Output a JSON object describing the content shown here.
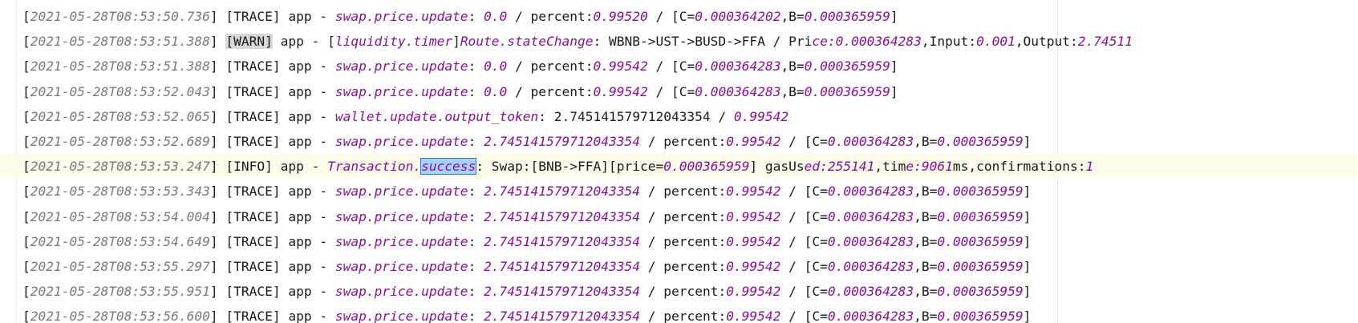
{
  "log": {
    "lines": [
      {
        "ts": "2021-05-28T08:53:50.736",
        "level": "TRACE",
        "logger": "app",
        "segments": [
          {
            "t": "swap.price.update",
            "s": "it"
          },
          {
            "t": ": ",
            "s": "plain"
          },
          {
            "t": "0.0",
            "s": "num"
          },
          {
            "t": " / percent:",
            "s": "plain"
          },
          {
            "t": "0.99520",
            "s": "num"
          },
          {
            "t": " / [C=",
            "s": "plain"
          },
          {
            "t": "0.000364202",
            "s": "num"
          },
          {
            "t": ",B=",
            "s": "plain"
          },
          {
            "t": "0.000365959",
            "s": "num"
          },
          {
            "t": "]",
            "s": "plain"
          }
        ]
      },
      {
        "ts": "2021-05-28T08:53:51.388",
        "level": "WARN",
        "logger": "app",
        "segments": [
          {
            "t": "[",
            "s": "plain"
          },
          {
            "t": "liquidity.timer",
            "s": "it"
          },
          {
            "t": "]",
            "s": "plain"
          },
          {
            "t": "Route.stateChange",
            "s": "it"
          },
          {
            "t": ": WBNB->UST->BUSD->FFA / Pri",
            "s": "plain"
          },
          {
            "t": "ce:0.000364283",
            "s": "num"
          },
          {
            "t": ",Input:",
            "s": "plain"
          },
          {
            "t": "0.001",
            "s": "num"
          },
          {
            "t": ",Output:",
            "s": "plain"
          },
          {
            "t": "2.74511",
            "s": "num"
          }
        ]
      },
      {
        "ts": "2021-05-28T08:53:51.388",
        "level": "TRACE",
        "logger": "app",
        "segments": [
          {
            "t": "swap.price.update",
            "s": "it"
          },
          {
            "t": ": ",
            "s": "plain"
          },
          {
            "t": "0.0",
            "s": "num"
          },
          {
            "t": " / percent:",
            "s": "plain"
          },
          {
            "t": "0.99542",
            "s": "num"
          },
          {
            "t": " / [C=",
            "s": "plain"
          },
          {
            "t": "0.000364283",
            "s": "num"
          },
          {
            "t": ",B=",
            "s": "plain"
          },
          {
            "t": "0.000365959",
            "s": "num"
          },
          {
            "t": "]",
            "s": "plain"
          }
        ]
      },
      {
        "ts": "2021-05-28T08:53:52.043",
        "level": "TRACE",
        "logger": "app",
        "segments": [
          {
            "t": "swap.price.update",
            "s": "it"
          },
          {
            "t": ": ",
            "s": "plain"
          },
          {
            "t": "0.0",
            "s": "num"
          },
          {
            "t": " / percent:",
            "s": "plain"
          },
          {
            "t": "0.99542",
            "s": "num"
          },
          {
            "t": " / [C=",
            "s": "plain"
          },
          {
            "t": "0.000364283",
            "s": "num"
          },
          {
            "t": ",B=",
            "s": "plain"
          },
          {
            "t": "0.000365959",
            "s": "num"
          },
          {
            "t": "]",
            "s": "plain"
          }
        ]
      },
      {
        "ts": "2021-05-28T08:53:52.065",
        "level": "TRACE",
        "logger": "app",
        "segments": [
          {
            "t": "wallet.update.output_token",
            "s": "it"
          },
          {
            "t": ": 2.745141579712043354 / ",
            "s": "plain"
          },
          {
            "t": "0.99542",
            "s": "num"
          }
        ]
      },
      {
        "ts": "2021-05-28T08:53:52.689",
        "level": "TRACE",
        "logger": "app",
        "segments": [
          {
            "t": "swap.price.update",
            "s": "it"
          },
          {
            "t": ": ",
            "s": "plain"
          },
          {
            "t": "2.745141579712043354",
            "s": "num"
          },
          {
            "t": " / percent:",
            "s": "plain"
          },
          {
            "t": "0.99542",
            "s": "num"
          },
          {
            "t": " / [C=",
            "s": "plain"
          },
          {
            "t": "0.000364283",
            "s": "num"
          },
          {
            "t": ",B=",
            "s": "plain"
          },
          {
            "t": "0.000365959",
            "s": "num"
          },
          {
            "t": "]",
            "s": "plain"
          }
        ]
      },
      {
        "ts": "2021-05-28T08:53:53.247",
        "level": "INFO",
        "logger": "app",
        "current": true,
        "segments": [
          {
            "t": "Transaction.",
            "s": "it"
          },
          {
            "t": "success",
            "s": "sel"
          },
          {
            "t": ": Swap:[BNB->FFA][price=",
            "s": "plain"
          },
          {
            "t": "0.000365959",
            "s": "num"
          },
          {
            "t": "] gasUs",
            "s": "plain"
          },
          {
            "t": "ed:255141",
            "s": "num"
          },
          {
            "t": ",tim",
            "s": "plain"
          },
          {
            "t": "e:9061",
            "s": "num"
          },
          {
            "t": "ms,confirmations:",
            "s": "plain"
          },
          {
            "t": "1",
            "s": "num"
          }
        ]
      },
      {
        "ts": "2021-05-28T08:53:53.343",
        "level": "TRACE",
        "logger": "app",
        "segments": [
          {
            "t": "swap.price.update",
            "s": "it"
          },
          {
            "t": ": ",
            "s": "plain"
          },
          {
            "t": "2.745141579712043354",
            "s": "num"
          },
          {
            "t": " / percent:",
            "s": "plain"
          },
          {
            "t": "0.99542",
            "s": "num"
          },
          {
            "t": " / [C=",
            "s": "plain"
          },
          {
            "t": "0.000364283",
            "s": "num"
          },
          {
            "t": ",B=",
            "s": "plain"
          },
          {
            "t": "0.000365959",
            "s": "num"
          },
          {
            "t": "]",
            "s": "plain"
          }
        ]
      },
      {
        "ts": "2021-05-28T08:53:54.004",
        "level": "TRACE",
        "logger": "app",
        "segments": [
          {
            "t": "swap.price.update",
            "s": "it"
          },
          {
            "t": ": ",
            "s": "plain"
          },
          {
            "t": "2.745141579712043354",
            "s": "num"
          },
          {
            "t": " / percent:",
            "s": "plain"
          },
          {
            "t": "0.99542",
            "s": "num"
          },
          {
            "t": " / [C=",
            "s": "plain"
          },
          {
            "t": "0.000364283",
            "s": "num"
          },
          {
            "t": ",B=",
            "s": "plain"
          },
          {
            "t": "0.000365959",
            "s": "num"
          },
          {
            "t": "]",
            "s": "plain"
          }
        ]
      },
      {
        "ts": "2021-05-28T08:53:54.649",
        "level": "TRACE",
        "logger": "app",
        "segments": [
          {
            "t": "swap.price.update",
            "s": "it"
          },
          {
            "t": ": ",
            "s": "plain"
          },
          {
            "t": "2.745141579712043354",
            "s": "num"
          },
          {
            "t": " / percent:",
            "s": "plain"
          },
          {
            "t": "0.99542",
            "s": "num"
          },
          {
            "t": " / [C=",
            "s": "plain"
          },
          {
            "t": "0.000364283",
            "s": "num"
          },
          {
            "t": ",B=",
            "s": "plain"
          },
          {
            "t": "0.000365959",
            "s": "num"
          },
          {
            "t": "]",
            "s": "plain"
          }
        ]
      },
      {
        "ts": "2021-05-28T08:53:55.297",
        "level": "TRACE",
        "logger": "app",
        "segments": [
          {
            "t": "swap.price.update",
            "s": "it"
          },
          {
            "t": ": ",
            "s": "plain"
          },
          {
            "t": "2.745141579712043354",
            "s": "num"
          },
          {
            "t": " / percent:",
            "s": "plain"
          },
          {
            "t": "0.99542",
            "s": "num"
          },
          {
            "t": " / [C=",
            "s": "plain"
          },
          {
            "t": "0.000364283",
            "s": "num"
          },
          {
            "t": ",B=",
            "s": "plain"
          },
          {
            "t": "0.000365959",
            "s": "num"
          },
          {
            "t": "]",
            "s": "plain"
          }
        ]
      },
      {
        "ts": "2021-05-28T08:53:55.951",
        "level": "TRACE",
        "logger": "app",
        "segments": [
          {
            "t": "swap.price.update",
            "s": "it"
          },
          {
            "t": ": ",
            "s": "plain"
          },
          {
            "t": "2.745141579712043354",
            "s": "num"
          },
          {
            "t": " / percent:",
            "s": "plain"
          },
          {
            "t": "0.99542",
            "s": "num"
          },
          {
            "t": " / [C=",
            "s": "plain"
          },
          {
            "t": "0.000364283",
            "s": "num"
          },
          {
            "t": ",B=",
            "s": "plain"
          },
          {
            "t": "0.000365959",
            "s": "num"
          },
          {
            "t": "]",
            "s": "plain"
          }
        ]
      },
      {
        "ts": "2021-05-28T08:53:56.600",
        "level": "TRACE",
        "logger": "app",
        "segments": [
          {
            "t": "swap.price.update",
            "s": "it"
          },
          {
            "t": ": ",
            "s": "plain"
          },
          {
            "t": "2.745141579712043354",
            "s": "num"
          },
          {
            "t": " / percent:",
            "s": "plain"
          },
          {
            "t": "0.99542",
            "s": "num"
          },
          {
            "t": " / [C=",
            "s": "plain"
          },
          {
            "t": "0.000364283",
            "s": "num"
          },
          {
            "t": ",B=",
            "s": "plain"
          },
          {
            "t": "0.000365959",
            "s": "num"
          },
          {
            "t": "]",
            "s": "plain"
          }
        ]
      }
    ]
  },
  "colors": {
    "background": "#ffffff",
    "text": "#1a1a1a",
    "timestamp": "#7a7a7a",
    "keyword": "#871094",
    "current_line": "#fdfbea",
    "warn_level_bg": "#d7d7d7",
    "selection": "#a6d2ff"
  }
}
